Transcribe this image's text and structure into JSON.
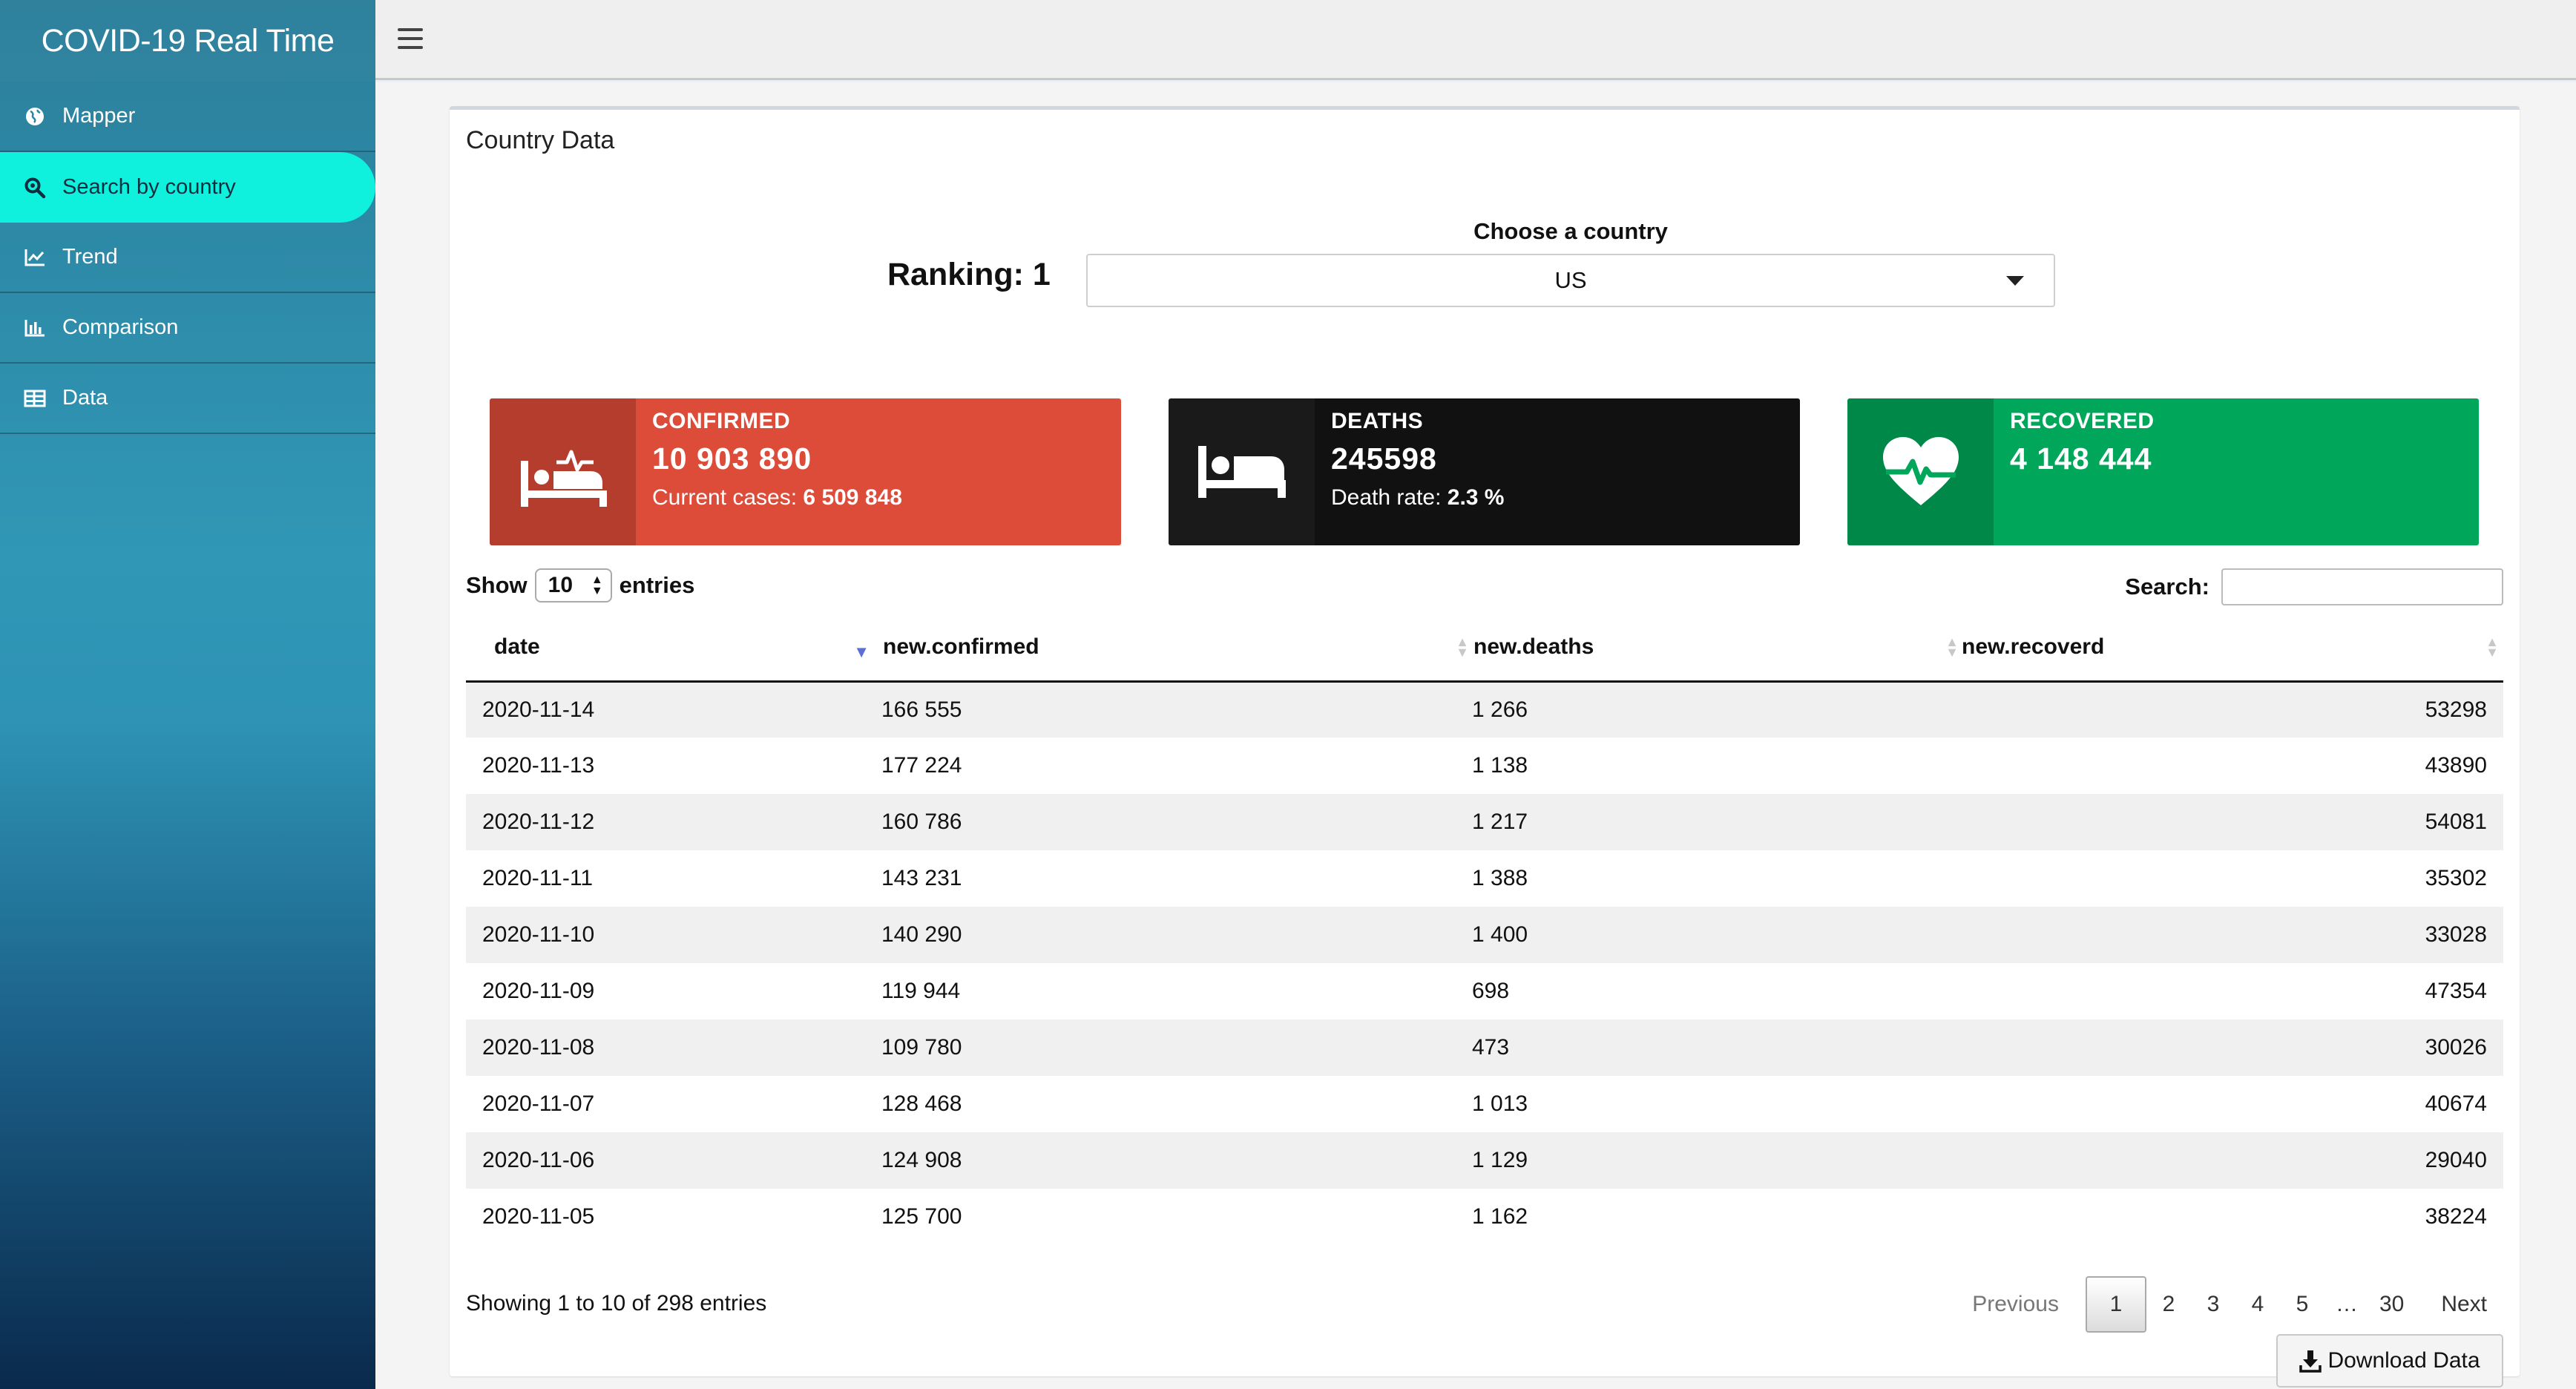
{
  "app": {
    "title": "COVID-19 Real Time"
  },
  "sidebar": {
    "items": [
      {
        "label": "Mapper",
        "icon": "globe-icon"
      },
      {
        "label": "Search by country",
        "icon": "search-icon"
      },
      {
        "label": "Trend",
        "icon": "line-chart-icon"
      },
      {
        "label": "Comparison",
        "icon": "bar-chart-icon"
      },
      {
        "label": "Data",
        "icon": "table-icon"
      }
    ],
    "active_index": 1,
    "active_color": "#0ff0dd"
  },
  "box": {
    "title": "Country Data"
  },
  "ranking": {
    "text": "Ranking: 1"
  },
  "country_select": {
    "label": "Choose a country",
    "value": "US"
  },
  "value_boxes": {
    "confirmed": {
      "label": "CONFIRMED",
      "value": "10 903 890",
      "sub_label": "Current cases: ",
      "sub_value": "6 509 848",
      "color": "#dd4b39",
      "icon": "patient-bed-icon"
    },
    "deaths": {
      "label": "DEATHS",
      "value": "245598",
      "sub_label": "Death rate: ",
      "sub_value": "2.3 %",
      "color": "#111111",
      "icon": "bed-icon"
    },
    "recovered": {
      "label": "RECOVERED",
      "value": "4 148 444",
      "color": "#00a65a",
      "icon": "heartbeat-icon"
    }
  },
  "table_controls": {
    "show": "Show",
    "length": "10",
    "entries": "entries",
    "search_label": "Search:",
    "search_value": ""
  },
  "table": {
    "columns": [
      "date",
      "new.confirmed",
      "new.deaths",
      "new.recoverd"
    ],
    "rows": [
      [
        "2020-11-14",
        "166 555",
        "1 266",
        "53298"
      ],
      [
        "2020-11-13",
        "177 224",
        "1 138",
        "43890"
      ],
      [
        "2020-11-12",
        "160 786",
        "1 217",
        "54081"
      ],
      [
        "2020-11-11",
        "143 231",
        "1 388",
        "35302"
      ],
      [
        "2020-11-10",
        "140 290",
        "1 400",
        "33028"
      ],
      [
        "2020-11-09",
        "119 944",
        "698",
        "47354"
      ],
      [
        "2020-11-08",
        "109 780",
        "473",
        "30026"
      ],
      [
        "2020-11-07",
        "128 468",
        "1 013",
        "40674"
      ],
      [
        "2020-11-06",
        "124 908",
        "1 129",
        "29040"
      ],
      [
        "2020-11-05",
        "125 700",
        "1 162",
        "38224"
      ]
    ]
  },
  "info": "Showing 1 to 10 of 298 entries",
  "pagination": {
    "previous": "Previous",
    "pages": [
      "1",
      "2",
      "3",
      "4",
      "5",
      "…",
      "30"
    ],
    "current": "1",
    "next": "Next"
  },
  "download": {
    "label": "Download Data"
  }
}
